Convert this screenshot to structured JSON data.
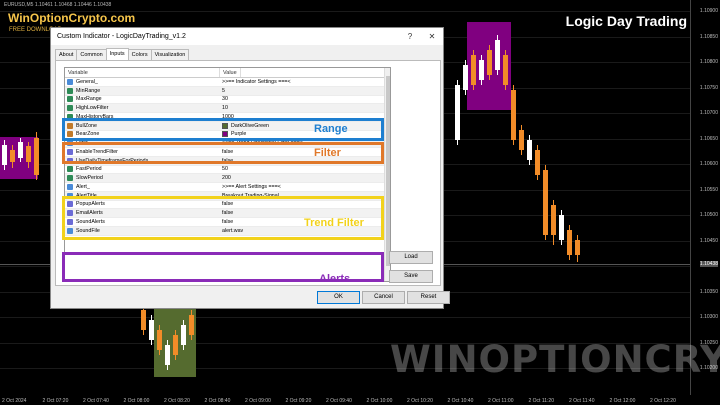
{
  "chart": {
    "symbol_info": "EURUSD,M5  1.10461 1.10468 1.10446 1.10438",
    "brand": "WinOptionCrypto.com",
    "brand_sub": "FREE DOWNLOAD",
    "overlay_title": "Logic Day Trading",
    "watermark": "WINOPTIONCRYPTO.COM",
    "price_ticks": [
      "1.10900",
      "1.10850",
      "1.10800",
      "1.10750",
      "1.10700",
      "1.10650",
      "1.10600",
      "1.10550",
      "1.10500",
      "1.10450",
      "1.10400",
      "1.10350",
      "1.10300",
      "1.10250",
      "1.10200"
    ],
    "current_price": "1.10438",
    "time_ticks": [
      "2 Oct 2024",
      "2 Oct 07:20",
      "2 Oct 07:40",
      "2 Oct 08:00",
      "2 Oct 08:20",
      "2 Oct 08:40",
      "2 Oct 09:00",
      "2 Oct 09:20",
      "2 Oct 09:40",
      "2 Oct 10:00",
      "2 Oct 10:20",
      "2 Oct 10:40",
      "2 Oct 11:00",
      "2 Oct 11:20",
      "2 Oct 11:40",
      "2 Oct 12:00",
      "2 Oct 12:20"
    ],
    "colors": {
      "bull": "#f28c28",
      "bear": "#ffffff",
      "bear_zone": "#800080",
      "bull_zone": "#556b2f"
    }
  },
  "dialog": {
    "title": "Custom Indicator - LogicDayTrading_v1.2",
    "help": "?",
    "close": "✕",
    "tabs": [
      "About",
      "Common",
      "Inputs",
      "Colors",
      "Visualization"
    ],
    "active_tab": "Inputs",
    "columns": {
      "variable": "Variable",
      "value": "Value"
    },
    "rows": [
      {
        "icon": "ab",
        "var": "General_",
        "val": ">>== Indicator Settings ===<"
      },
      {
        "icon": "num",
        "var": "MinRange",
        "val": "5"
      },
      {
        "icon": "num",
        "var": "MaxRange",
        "val": "30"
      },
      {
        "icon": "num",
        "var": "HighLowFilter",
        "val": "10"
      },
      {
        "icon": "num",
        "var": "MaxHistoryBars",
        "val": "1000"
      },
      {
        "icon": "color",
        "var": "BullZone",
        "val": "DarkOliveGreen",
        "swatch": "#556b2f"
      },
      {
        "icon": "color",
        "var": "BearZone",
        "val": "Purple",
        "swatch": "#800080"
      },
      {
        "icon": "ab",
        "var": "Filter_",
        "val": ">>== Trend Directional Filter ===<"
      },
      {
        "icon": "bool",
        "var": "EnableTrendFilter",
        "val": "false"
      },
      {
        "icon": "bool",
        "var": "UseDailyTimeframeForPeriods",
        "val": "false"
      },
      {
        "icon": "num",
        "var": "FastPeriod",
        "val": "50"
      },
      {
        "icon": "num",
        "var": "SlowPeriod",
        "val": "200"
      },
      {
        "icon": "ab",
        "var": "Alert_",
        "val": ">>== Alert Settings ===<"
      },
      {
        "icon": "ab",
        "var": "AlertTitle",
        "val": "Breakout Trading-Signal"
      },
      {
        "icon": "bool",
        "var": "PopupAlerts",
        "val": "false"
      },
      {
        "icon": "bool",
        "var": "EmailAlerts",
        "val": "false"
      },
      {
        "icon": "bool",
        "var": "SoundAlerts",
        "val": "false"
      },
      {
        "icon": "ab",
        "var": "SoundFile",
        "val": "alert.wav"
      }
    ],
    "highlights": {
      "range": {
        "label": "Range",
        "color": "#1e7fd0"
      },
      "filter": {
        "label": "Filter",
        "color": "#e0782a"
      },
      "trend": {
        "label": "Trend Filter",
        "color": "#f2d21b"
      },
      "alerts": {
        "label": "Alerts",
        "color": "#8a2bb8"
      }
    },
    "buttons": {
      "load": "Load",
      "save": "Save",
      "ok": "OK",
      "cancel": "Cancel",
      "reset": "Reset"
    }
  }
}
